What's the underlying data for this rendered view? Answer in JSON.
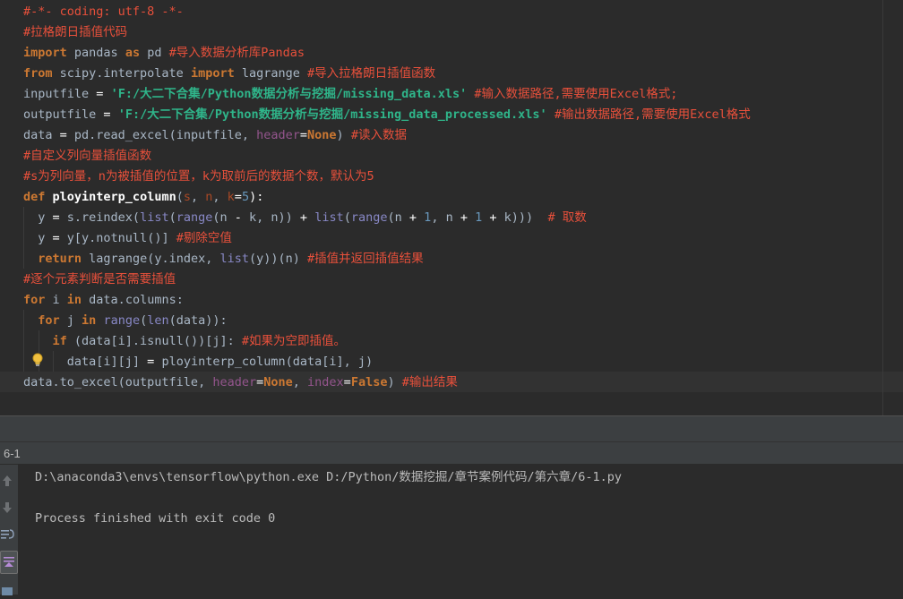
{
  "editor": {
    "lines": [
      [
        {
          "t": "#-*- coding: utf-8 -*-",
          "c": "com"
        }
      ],
      [
        {
          "t": "#拉格朗日插值代码",
          "c": "com"
        }
      ],
      [
        {
          "t": "import",
          "c": "kw"
        },
        {
          "t": " pandas ",
          "c": "txt"
        },
        {
          "t": "as",
          "c": "kw"
        },
        {
          "t": " pd ",
          "c": "txt"
        },
        {
          "t": "#导入数据分析库Pandas",
          "c": "com"
        }
      ],
      [
        {
          "t": "from",
          "c": "kw"
        },
        {
          "t": " scipy.interpolate ",
          "c": "txt"
        },
        {
          "t": "import",
          "c": "kw"
        },
        {
          "t": " lagrange ",
          "c": "txt"
        },
        {
          "t": "#导入拉格朗日插值函数",
          "c": "com"
        }
      ],
      [
        {
          "t": "inputfile ",
          "c": "txt"
        },
        {
          "t": "=",
          "c": "op"
        },
        {
          "t": " ",
          "c": "txt"
        },
        {
          "t": "'F:/大二下合集/Python数据分析与挖掘/missing_data.xls'",
          "c": "str"
        },
        {
          "t": " ",
          "c": "txt"
        },
        {
          "t": "#输入数据路径,需要使用Excel格式;",
          "c": "com"
        }
      ],
      [
        {
          "t": "outputfile ",
          "c": "txt"
        },
        {
          "t": "=",
          "c": "op"
        },
        {
          "t": " ",
          "c": "txt"
        },
        {
          "t": "'F:/大二下合集/Python数据分析与挖掘/missing_data_processed.xls'",
          "c": "str"
        },
        {
          "t": " ",
          "c": "txt"
        },
        {
          "t": "#输出数据路径,需要使用Excel格式",
          "c": "com"
        }
      ],
      [
        {
          "t": "data ",
          "c": "txt"
        },
        {
          "t": "=",
          "c": "op"
        },
        {
          "t": " pd.read_excel(inputfile, ",
          "c": "txt"
        },
        {
          "t": "header",
          "c": "prm"
        },
        {
          "t": "=",
          "c": "op"
        },
        {
          "t": "None",
          "c": "kw"
        },
        {
          "t": ") ",
          "c": "txt"
        },
        {
          "t": "#读入数据",
          "c": "com"
        }
      ],
      [
        {
          "t": "#自定义列向量插值函数",
          "c": "com"
        }
      ],
      [
        {
          "t": "#s为列向量，n为被插值的位置，k为取前后的数据个数，默认为5",
          "c": "com"
        }
      ],
      [
        {
          "t": "def",
          "c": "kw"
        },
        {
          "t": " ",
          "c": "txt"
        },
        {
          "t": "ployinterp_column",
          "c": "fn"
        },
        {
          "t": "(",
          "c": "txt"
        },
        {
          "t": "s",
          "c": "par"
        },
        {
          "t": ", ",
          "c": "txt"
        },
        {
          "t": "n",
          "c": "par"
        },
        {
          "t": ", ",
          "c": "txt"
        },
        {
          "t": "k",
          "c": "par"
        },
        {
          "t": "=",
          "c": "op"
        },
        {
          "t": "5",
          "c": "num"
        },
        {
          "t": "):",
          "c": "op"
        }
      ],
      [
        {
          "t": "  y ",
          "c": "txt"
        },
        {
          "t": "=",
          "c": "op"
        },
        {
          "t": " s.reindex(",
          "c": "txt"
        },
        {
          "t": "list",
          "c": "bi"
        },
        {
          "t": "(",
          "c": "txt"
        },
        {
          "t": "range",
          "c": "bi"
        },
        {
          "t": "(n ",
          "c": "txt"
        },
        {
          "t": "-",
          "c": "op"
        },
        {
          "t": " k, n)) ",
          "c": "txt"
        },
        {
          "t": "+",
          "c": "op"
        },
        {
          "t": " ",
          "c": "txt"
        },
        {
          "t": "list",
          "c": "bi"
        },
        {
          "t": "(",
          "c": "txt"
        },
        {
          "t": "range",
          "c": "bi"
        },
        {
          "t": "(n ",
          "c": "txt"
        },
        {
          "t": "+",
          "c": "op"
        },
        {
          "t": " ",
          "c": "txt"
        },
        {
          "t": "1",
          "c": "num"
        },
        {
          "t": ", n ",
          "c": "txt"
        },
        {
          "t": "+",
          "c": "op"
        },
        {
          "t": " ",
          "c": "txt"
        },
        {
          "t": "1",
          "c": "num"
        },
        {
          "t": " ",
          "c": "txt"
        },
        {
          "t": "+",
          "c": "op"
        },
        {
          "t": " k)))  ",
          "c": "txt"
        },
        {
          "t": "# 取数",
          "c": "com"
        }
      ],
      [
        {
          "t": "  y ",
          "c": "txt"
        },
        {
          "t": "=",
          "c": "op"
        },
        {
          "t": " y[y.notnull()] ",
          "c": "txt"
        },
        {
          "t": "#剔除空值",
          "c": "com"
        }
      ],
      [
        {
          "t": "  ",
          "c": "txt"
        },
        {
          "t": "return",
          "c": "kw"
        },
        {
          "t": " lagrange(y.index, ",
          "c": "txt"
        },
        {
          "t": "list",
          "c": "bi"
        },
        {
          "t": "(y))(n) ",
          "c": "txt"
        },
        {
          "t": "#插值并返回插值结果",
          "c": "com"
        }
      ],
      [
        {
          "t": "#逐个元素判断是否需要插值",
          "c": "com"
        }
      ],
      [
        {
          "t": "for",
          "c": "kw"
        },
        {
          "t": " i ",
          "c": "txt"
        },
        {
          "t": "in",
          "c": "kw"
        },
        {
          "t": " data.columns:",
          "c": "txt"
        }
      ],
      [
        {
          "t": "  ",
          "c": "txt"
        },
        {
          "t": "for",
          "c": "kw"
        },
        {
          "t": " j ",
          "c": "txt"
        },
        {
          "t": "in",
          "c": "kw"
        },
        {
          "t": " ",
          "c": "txt"
        },
        {
          "t": "range",
          "c": "bi"
        },
        {
          "t": "(",
          "c": "txt"
        },
        {
          "t": "len",
          "c": "bi"
        },
        {
          "t": "(data)):",
          "c": "txt"
        }
      ],
      [
        {
          "t": "    ",
          "c": "txt"
        },
        {
          "t": "if",
          "c": "kw"
        },
        {
          "t": " (data[i].isnull())[j]: ",
          "c": "txt"
        },
        {
          "t": "#如果为空即插值。",
          "c": "com"
        }
      ],
      [
        {
          "t": "      data[i][j] ",
          "c": "txt"
        },
        {
          "t": "=",
          "c": "op"
        },
        {
          "t": " ployinterp_column(data[i], j)",
          "c": "txt"
        }
      ],
      [
        {
          "t": "data.to_excel(outputfile, ",
          "c": "txt"
        },
        {
          "t": "header",
          "c": "prm"
        },
        {
          "t": "=",
          "c": "op"
        },
        {
          "t": "None",
          "c": "kw"
        },
        {
          "t": ", ",
          "c": "txt"
        },
        {
          "t": "index",
          "c": "prm"
        },
        {
          "t": "=",
          "c": "op"
        },
        {
          "t": "False",
          "c": "kw"
        },
        {
          "t": ") ",
          "c": "txt"
        },
        {
          "t": "#输出结果",
          "c": "com"
        }
      ]
    ]
  },
  "run": {
    "tab_label": "6-1",
    "console_lines": [
      "D:\\anaconda3\\envs\\tensorflow\\python.exe D:/Python/数据挖掘/章节案例代码/第六章/6-1.py",
      "",
      "Process finished with exit code 0"
    ]
  },
  "icons": {
    "bulb": "lightbulb-icon",
    "toolbar": [
      "up-arrow-icon",
      "down-arrow-icon",
      "soft-wrap-icon",
      "scroll-to-end-icon",
      "print-icon"
    ]
  },
  "colors": {
    "background": "#2b2b2b",
    "comment": "#e8503b",
    "keyword": "#cc7832",
    "string": "#2fb58a",
    "number": "#6897bb",
    "builtin": "#8888c6",
    "parameter": "#aa4926",
    "keyword_arg": "#94558d"
  }
}
